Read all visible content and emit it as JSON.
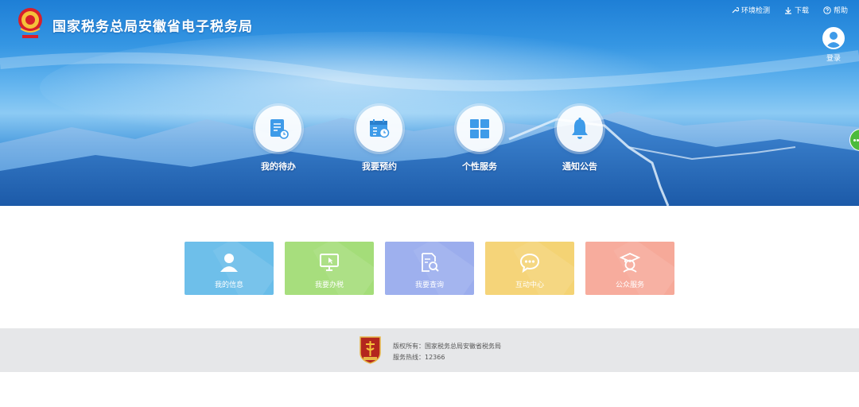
{
  "header": {
    "site_title": "国家税务总局安徽省电子税务局",
    "links": [
      {
        "label": "环境检测",
        "icon": "wrench-icon"
      },
      {
        "label": "下载",
        "icon": "download-icon"
      },
      {
        "label": "帮助",
        "icon": "help-icon"
      }
    ],
    "login_label": "登录"
  },
  "hero_nav": [
    {
      "label": "我的待办",
      "icon": "todo-list-icon"
    },
    {
      "label": "我要预约",
      "icon": "calendar-clock-icon"
    },
    {
      "label": "个性服务",
      "icon": "grid-icon"
    },
    {
      "label": "通知公告",
      "icon": "bell-icon"
    }
  ],
  "tiles": [
    {
      "label": "我的信息",
      "icon": "user-icon",
      "color": "#5eb8e8"
    },
    {
      "label": "我要办税",
      "icon": "monitor-icon",
      "color": "#9edb6f"
    },
    {
      "label": "我要查询",
      "icon": "document-search-icon",
      "color": "#94a7ec"
    },
    {
      "label": "互动中心",
      "icon": "chat-icon",
      "color": "#f4d06a"
    },
    {
      "label": "公众服务",
      "icon": "graduate-icon",
      "color": "#f6a392"
    }
  ],
  "footer": {
    "copyright": "版权所有：国家税务总局安徽省税务局",
    "hotline": "服务热线：12366"
  },
  "colors": {
    "hero_blue": "#2f8ee0",
    "icon_blue": "#3e9be9",
    "footer_bg": "#e6e7e9",
    "side_tab_green": "#4cbb3c"
  }
}
